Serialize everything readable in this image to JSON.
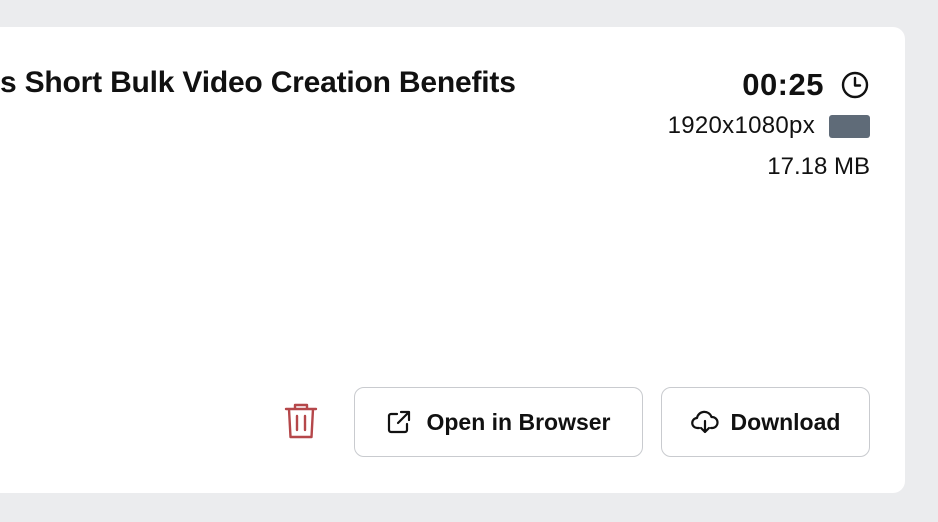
{
  "video": {
    "title": "s Short Bulk Video Creation Benefits",
    "duration": "00:25",
    "resolution": "1920x1080px",
    "file_size": "17.18 MB"
  },
  "actions": {
    "open_label": "Open in Browser",
    "download_label": "Download"
  },
  "icons": {
    "clock": "clock-icon",
    "aspect": "landscape-aspect-icon",
    "trash": "trash-icon",
    "external": "external-link-icon",
    "download": "cloud-download-icon"
  },
  "colors": {
    "background": "#ebecee",
    "card": "#ffffff",
    "text": "#111111",
    "aspect_fill": "#5f6b78",
    "trash": "#b5474a",
    "button_border": "#c9cbcf"
  }
}
